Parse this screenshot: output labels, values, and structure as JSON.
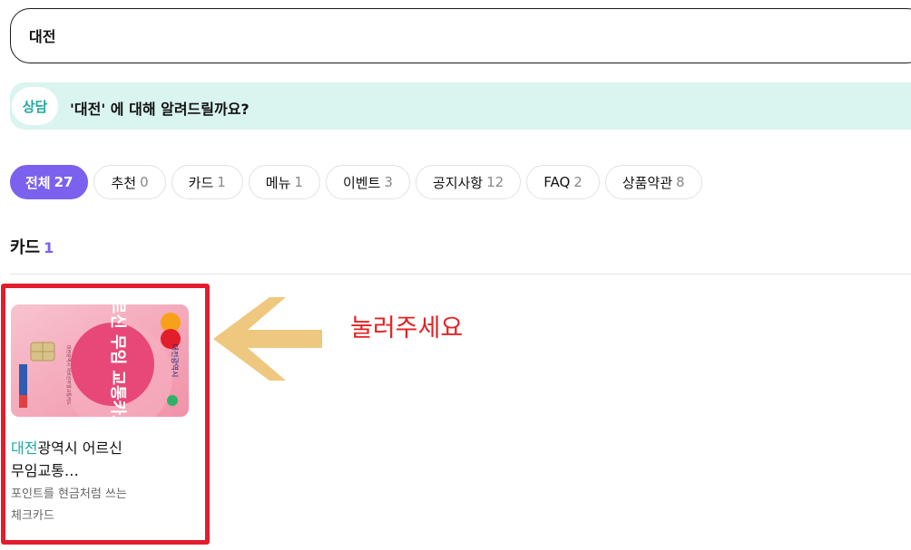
{
  "search": {
    "value": "대전"
  },
  "consult": {
    "badge": "상담",
    "message": "'대전' 에 대해 알려드릴까요?",
    "accent_color": "#1ea9a0",
    "background": "#daf4ef"
  },
  "filters": [
    {
      "label": "전체",
      "count": "27",
      "active": true
    },
    {
      "label": "추천",
      "count": "0",
      "active": false
    },
    {
      "label": "카드",
      "count": "1",
      "active": false
    },
    {
      "label": "메뉴",
      "count": "1",
      "active": false
    },
    {
      "label": "이벤트",
      "count": "3",
      "active": false
    },
    {
      "label": "공지사항",
      "count": "12",
      "active": false
    },
    {
      "label": "FAQ",
      "count": "2",
      "active": false
    },
    {
      "label": "상품약관",
      "count": "8",
      "active": false
    }
  ],
  "filter_active_color": "#7b61ee",
  "section": {
    "title": "카드",
    "count": "1"
  },
  "card": {
    "name_highlight": "대전",
    "name_rest_line1": "광역시 어르신",
    "name_line2": "무임교통…",
    "desc_line1": "포인트를 현금처럼 쓰는",
    "desc_line2": "체크카드",
    "image_text": "어르신 무임 교통카드",
    "image_side_text": "대전광역시",
    "image_small_text": "대전광역시 어르신무임교통카드",
    "image_bg_color": "#f4a6b8"
  },
  "annotation": {
    "text": "눌러주세요",
    "color": "#e32222",
    "arrow_icon": "arrow-left-icon",
    "arrow_color": "#eec87f",
    "highlight_box_color": "#e21d2c"
  }
}
